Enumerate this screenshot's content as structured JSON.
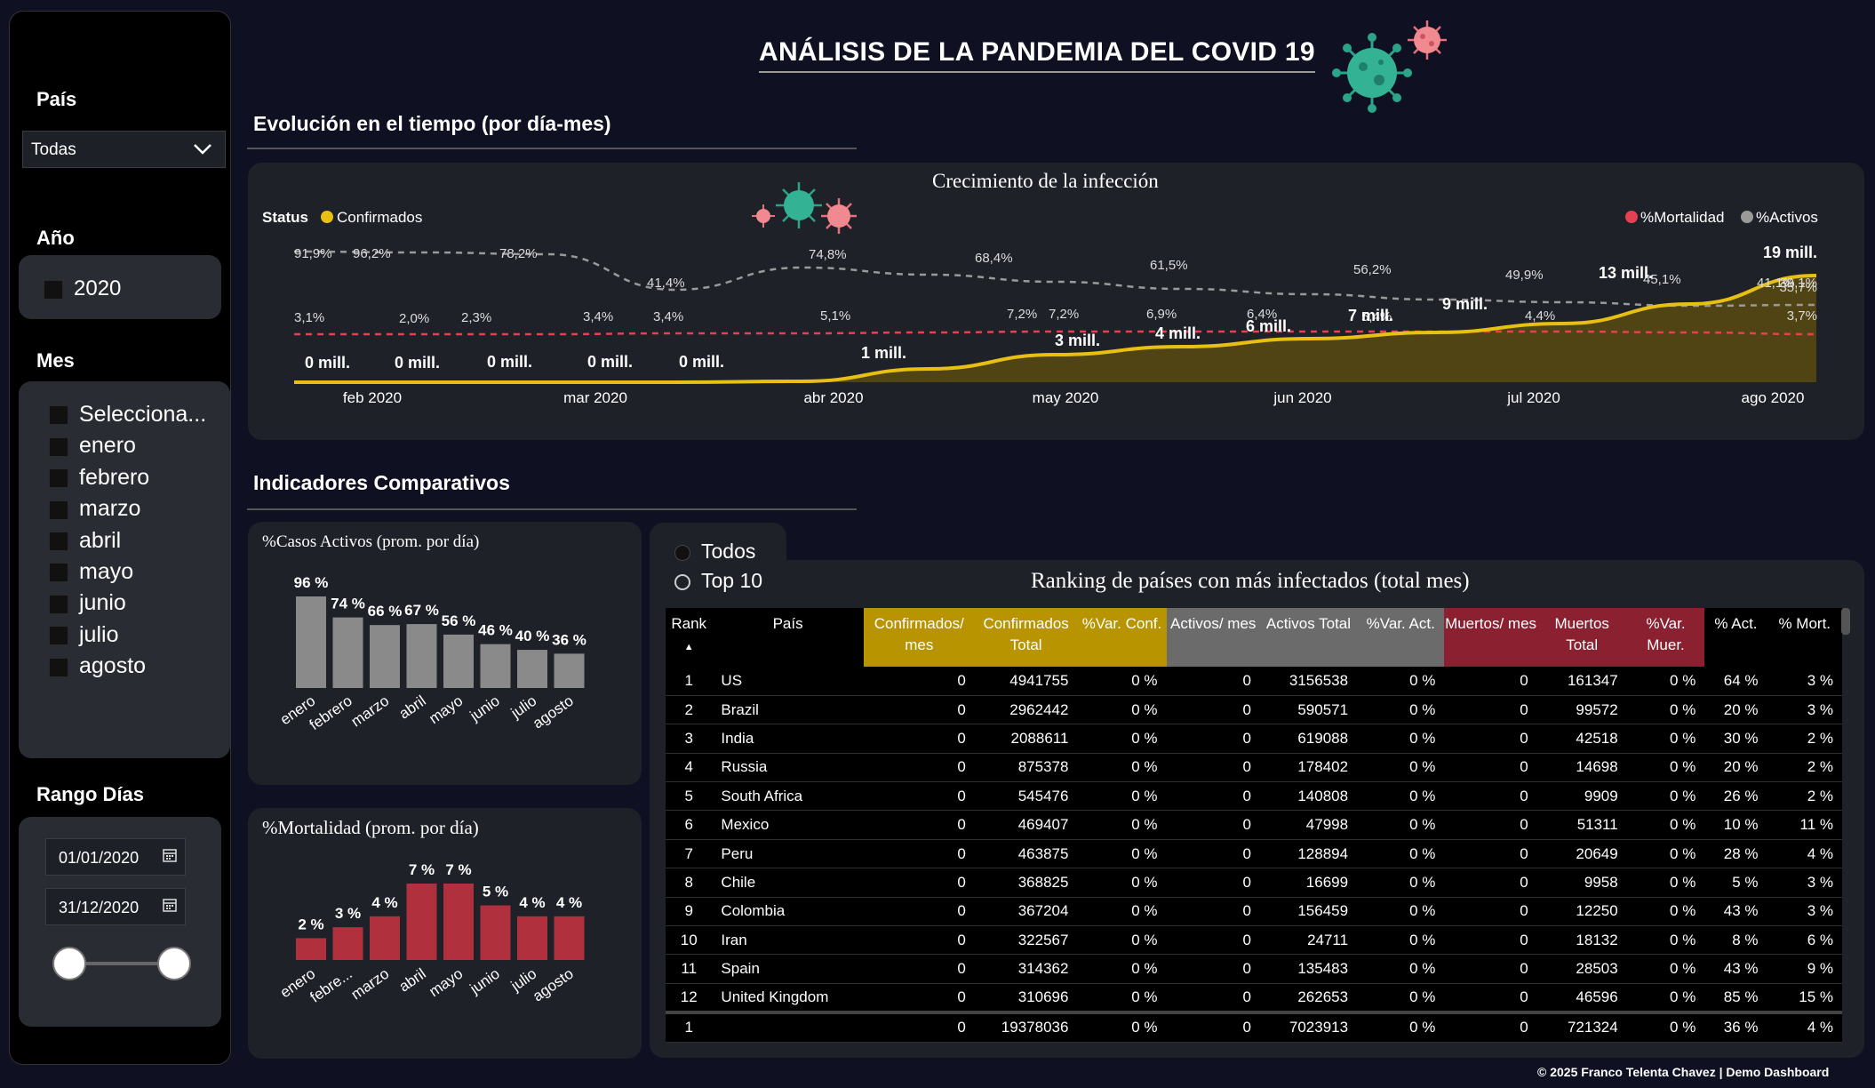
{
  "title": "ANÁLISIS DE LA PANDEMIA DEL COVID 19",
  "footer": "© 2025 Franco Telenta Chavez | Demo Dashboard",
  "sidebar": {
    "pais_label": "País",
    "pais_value": "Todas",
    "anio_label": "Año",
    "anio_value": "2020",
    "mes_label": "Mes",
    "months": [
      "Selecciona...",
      "enero",
      "febrero",
      "marzo",
      "abril",
      "mayo",
      "junio",
      "julio",
      "agosto"
    ],
    "rango_label": "Rango Días",
    "date_from": "01/01/2020",
    "date_to": "31/12/2020"
  },
  "sections": {
    "evolucion": "Evolución en el tiempo  (por día-mes)",
    "indicadores": "Indicadores Comparativos"
  },
  "colors": {
    "confirmed": "#e8c012",
    "mortality": "#e84050",
    "active": "#9a9a9a",
    "bar_grey": "#8a8a8a",
    "bar_red": "#b0303e"
  },
  "timeline": {
    "title": "Crecimiento de la infección",
    "legend_status": "Status",
    "legend_confirmados": "Confirmados",
    "legend_mortalidad": "%Mortalidad",
    "legend_activos": "%Activos",
    "x_ticks": [
      "feb 2020",
      "mar 2020",
      "abr 2020",
      "may 2020",
      "jun 2020",
      "jul 2020",
      "ago 2020"
    ],
    "conf_labels": [
      "0 mill.",
      "0 mill.",
      "0 mill.",
      "0 mill.",
      "0 mill.",
      "1 mill.",
      "3 mill.",
      "4 mill.",
      "6 mill.",
      "7 mill.",
      "9 mill.",
      "13 mill.",
      "19 mill."
    ],
    "active_labels": [
      "91,9%",
      "96,2%",
      "78,2%",
      "41,4%",
      "74,8%",
      "68,4%",
      "61,5%",
      "56,2%",
      "49,9%",
      "45,1%",
      "41,1%",
      "39,1%",
      "35,7%"
    ],
    "mort_labels": [
      "3,1%",
      "2,0%",
      "2,3%",
      "3,4%",
      "3,4%",
      "5,1%",
      "7,2%",
      "7,2%",
      "6,9%",
      "6,4%",
      "5,4%",
      "4,4%",
      "3,7%"
    ]
  },
  "chart_data": [
    {
      "type": "bar",
      "title": "%Casos Activos (prom. por día)",
      "categories": [
        "enero",
        "febrero",
        "marzo",
        "abril",
        "mayo",
        "junio",
        "julio",
        "agosto"
      ],
      "values": [
        96,
        74,
        66,
        67,
        56,
        46,
        40,
        36
      ],
      "labels": [
        "96 %",
        "74 %",
        "66 %",
        "67 %",
        "56 %",
        "46 %",
        "40 %",
        "36 %"
      ]
    },
    {
      "type": "bar",
      "title": "%Mortalidad (prom. por día)",
      "categories": [
        "enero",
        "febre...",
        "marzo",
        "abril",
        "mayo",
        "junio",
        "julio",
        "agosto"
      ],
      "values": [
        2,
        3,
        4,
        7,
        7,
        5,
        4,
        4
      ],
      "labels": [
        "2 %",
        "3 %",
        "4 %",
        "7 %",
        "7 %",
        "5 %",
        "4 %",
        "4 %"
      ]
    }
  ],
  "ranking": {
    "radio_all": "Todos",
    "radio_top": "Top 10",
    "title": "Ranking de países con más infectados (total mes)",
    "headers": [
      "Rank",
      "País",
      "Confirmados/ mes",
      "Confirmados Total",
      "%Var. Conf.",
      "Activos/ mes",
      "Activos Total",
      "%Var. Act.",
      "Muertos/ mes",
      "Muertos Total",
      "%Var. Muer.",
      "% Act.",
      "% Mort."
    ],
    "rows": [
      [
        "1",
        "US",
        "0",
        "4941755",
        "0 %",
        "0",
        "3156538",
        "0 %",
        "0",
        "161347",
        "0 %",
        "64 %",
        "3 %"
      ],
      [
        "2",
        "Brazil",
        "0",
        "2962442",
        "0 %",
        "0",
        "590571",
        "0 %",
        "0",
        "99572",
        "0 %",
        "20 %",
        "3 %"
      ],
      [
        "3",
        "India",
        "0",
        "2088611",
        "0 %",
        "0",
        "619088",
        "0 %",
        "0",
        "42518",
        "0 %",
        "30 %",
        "2 %"
      ],
      [
        "4",
        "Russia",
        "0",
        "875378",
        "0 %",
        "0",
        "178402",
        "0 %",
        "0",
        "14698",
        "0 %",
        "20 %",
        "2 %"
      ],
      [
        "5",
        "South Africa",
        "0",
        "545476",
        "0 %",
        "0",
        "140808",
        "0 %",
        "0",
        "9909",
        "0 %",
        "26 %",
        "2 %"
      ],
      [
        "6",
        "Mexico",
        "0",
        "469407",
        "0 %",
        "0",
        "47998",
        "0 %",
        "0",
        "51311",
        "0 %",
        "10 %",
        "11 %"
      ],
      [
        "7",
        "Peru",
        "0",
        "463875",
        "0 %",
        "0",
        "128894",
        "0 %",
        "0",
        "20649",
        "0 %",
        "28 %",
        "4 %"
      ],
      [
        "8",
        "Chile",
        "0",
        "368825",
        "0 %",
        "0",
        "16699",
        "0 %",
        "0",
        "9958",
        "0 %",
        "5 %",
        "3 %"
      ],
      [
        "9",
        "Colombia",
        "0",
        "367204",
        "0 %",
        "0",
        "156459",
        "0 %",
        "0",
        "12250",
        "0 %",
        "43 %",
        "3 %"
      ],
      [
        "10",
        "Iran",
        "0",
        "322567",
        "0 %",
        "0",
        "24711",
        "0 %",
        "0",
        "18132",
        "0 %",
        "8 %",
        "6 %"
      ],
      [
        "11",
        "Spain",
        "0",
        "314362",
        "0 %",
        "0",
        "135483",
        "0 %",
        "0",
        "28503",
        "0 %",
        "43 %",
        "9 %"
      ],
      [
        "12",
        "United Kingdom",
        "0",
        "310696",
        "0 %",
        "0",
        "262653",
        "0 %",
        "0",
        "46596",
        "0 %",
        "85 %",
        "15 %"
      ]
    ],
    "total": [
      "1",
      "",
      "0",
      "19378036",
      "0 %",
      "0",
      "7023913",
      "0 %",
      "0",
      "721324",
      "0 %",
      "36 %",
      "4 %"
    ]
  }
}
